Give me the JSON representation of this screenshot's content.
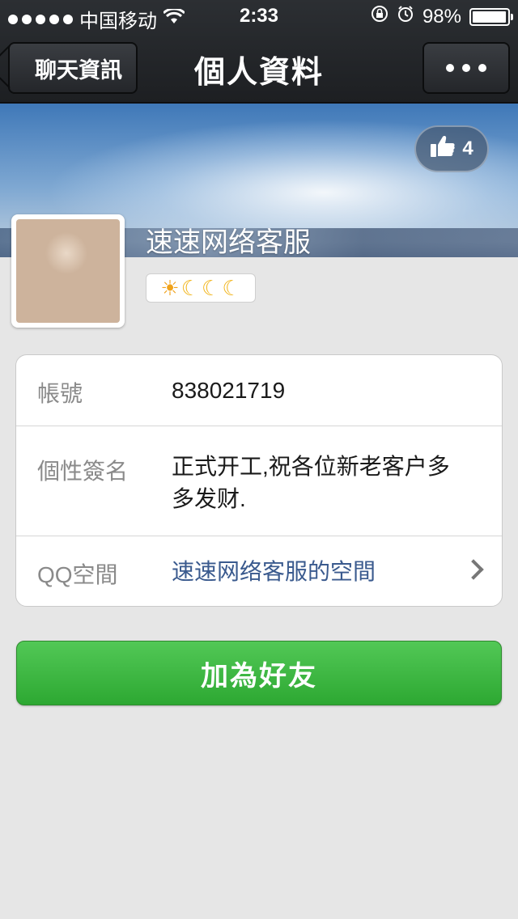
{
  "status_bar": {
    "carrier": "中国移动",
    "time": "2:33",
    "battery": "98%",
    "battery_level": 0.98
  },
  "nav": {
    "back_label": "聊天資訊",
    "title": "個人資料",
    "more_icon": "more-dots-icon"
  },
  "profile": {
    "name": "速速网络客服",
    "likes": "4",
    "level_icons": [
      "sun-icon",
      "moon-icon",
      "moon-icon",
      "moon-icon"
    ]
  },
  "info": {
    "account_label": "帳號",
    "account_value": "838021719",
    "signature_label": "個性簽名",
    "signature_value": "正式开工,祝各位新老客户多多发财.",
    "qzone_label": "QQ空間",
    "qzone_value": "速速网络客服的空間"
  },
  "actions": {
    "add_friend_label": "加為好友"
  },
  "colors": {
    "nav_bg": "#24262a",
    "accent_green": "#2da832",
    "link_blue": "#3a5a8e",
    "page_bg": "#e6e6e6"
  }
}
